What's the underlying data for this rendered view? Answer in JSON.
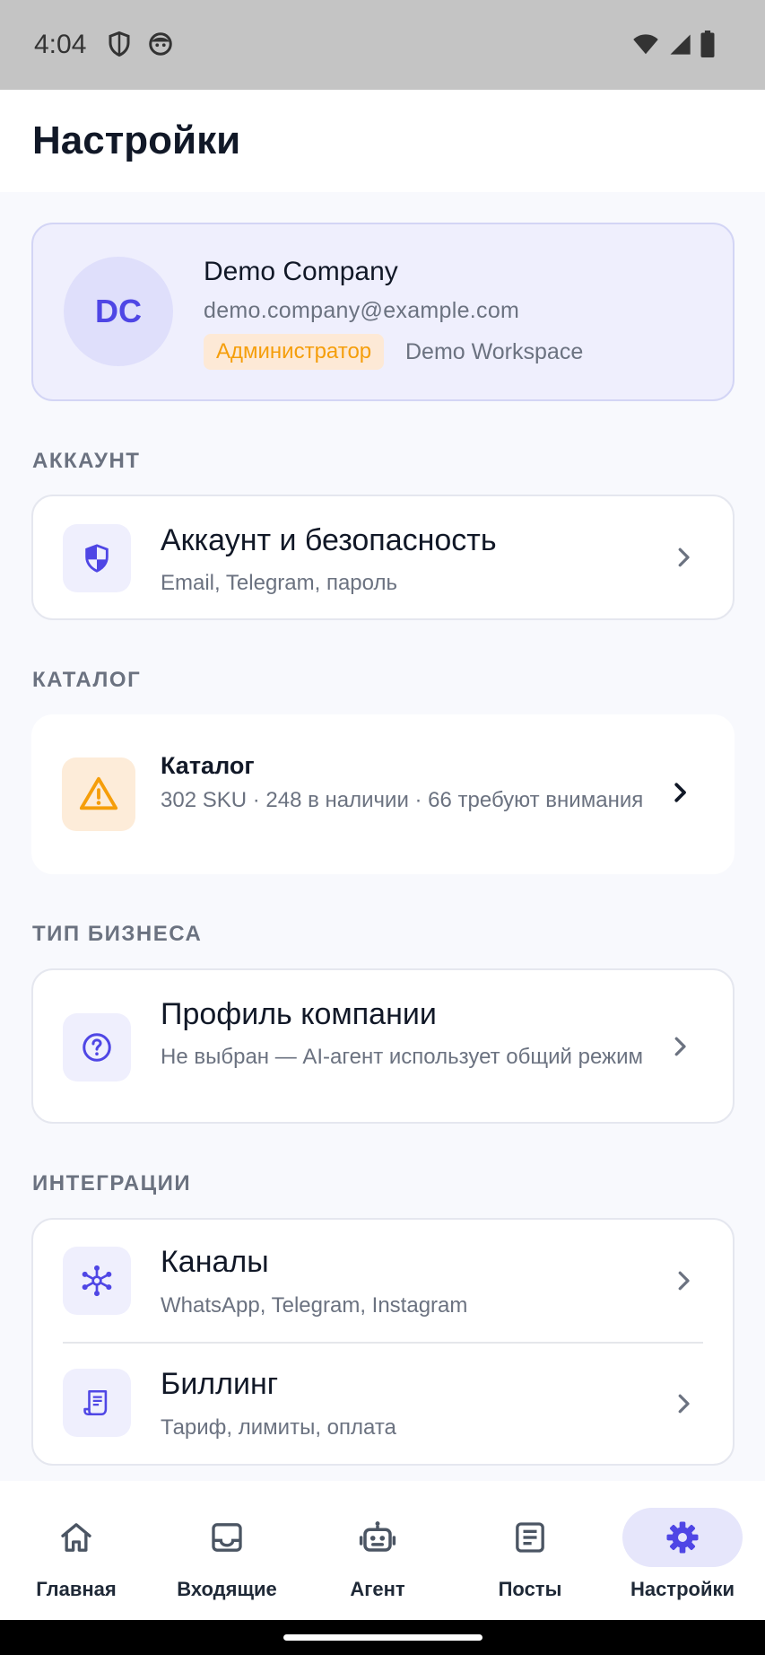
{
  "status_bar": {
    "time": "4:04"
  },
  "header": {
    "title": "Настройки"
  },
  "profile": {
    "initials": "DC",
    "name": "Demo Company",
    "email": "demo.company@example.com",
    "role": "Администратор",
    "workspace": "Demo Workspace"
  },
  "sections": {
    "account": {
      "label": "АККАУНТ",
      "items": [
        {
          "title": "Аккаунт и безопасность",
          "subtitle": "Email, Telegram, пароль",
          "icon": "shield-icon"
        }
      ]
    },
    "catalog": {
      "label": "КАТАЛОГ",
      "items": [
        {
          "title": "Каталог",
          "subtitle": "302 SKU · 248 в наличии · 66 требуют внимания",
          "icon": "warning-icon"
        }
      ]
    },
    "business": {
      "label": "ТИП БИЗНЕСА",
      "items": [
        {
          "title": "Профиль компании",
          "subtitle": "Не выбран — AI-агент использует общий режим",
          "icon": "question-icon"
        }
      ]
    },
    "integrations": {
      "label": "ИНТЕГРАЦИИ",
      "items": [
        {
          "title": "Каналы",
          "subtitle": "WhatsApp, Telegram, Instagram",
          "icon": "network-icon"
        },
        {
          "title": "Биллинг",
          "subtitle": "Тариф, лимиты, оплата",
          "icon": "receipt-icon"
        }
      ]
    }
  },
  "nav": {
    "items": [
      {
        "label": "Главная",
        "icon": "home-icon"
      },
      {
        "label": "Входящие",
        "icon": "inbox-icon"
      },
      {
        "label": "Агент",
        "icon": "robot-icon"
      },
      {
        "label": "Посты",
        "icon": "posts-icon"
      },
      {
        "label": "Настройки",
        "icon": "gear-icon",
        "active": true
      }
    ]
  },
  "colors": {
    "accent": "#4f46e5",
    "warning": "#f59e0b",
    "badge_bg": "#fde9d6"
  }
}
